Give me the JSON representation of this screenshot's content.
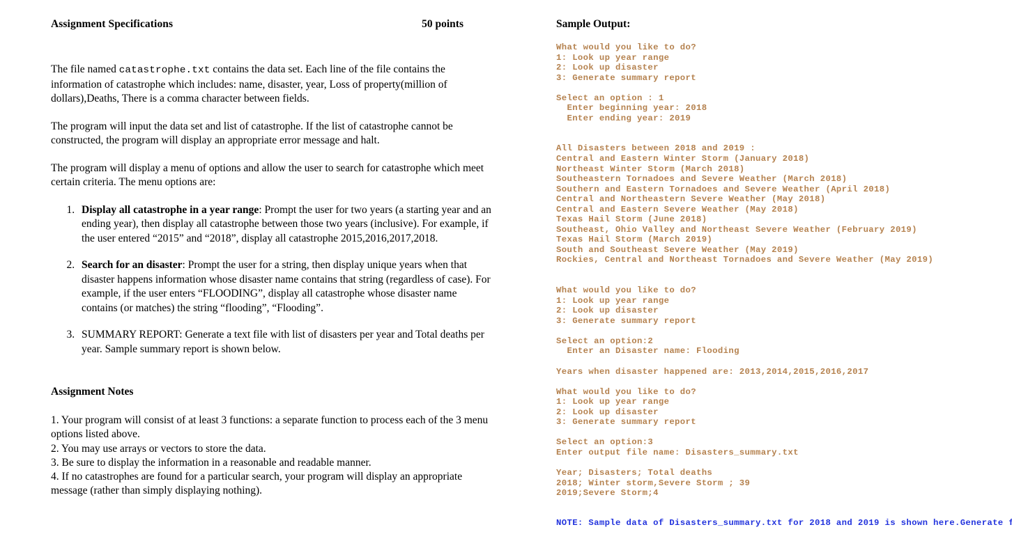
{
  "left": {
    "heading": "Assignment Specifications",
    "points": "50 points",
    "para1_a": "The file named ",
    "para1_file": "catastrophe.txt",
    "para1_b": " contains the data set.  Each line of the file contains the information of catastrophe which includes:  name, disaster, year, Loss of property(million of dollars),Deaths, There is a comma character between fields.",
    "para2": "The program will input the data set and list of catastrophe.  If the list of catastrophe cannot be constructed, the program will display an appropriate error message and halt.",
    "para3": "The program will display a menu of options and allow the user to search for catastrophe which meet certain criteria.  The menu options are:",
    "menu_items": [
      {
        "bold": "Display all catastrophe in a year range",
        "rest": ":  Prompt the user for two years (a starting year and an ending year), then display all catastrophe between those two years (inclusive).  For example, if the user entered “2015” and “2018”, display all catastrophe 2015,2016,2017,2018."
      },
      {
        "bold": "Search for an disaster",
        "rest": ":  Prompt the user for a string, then display unique years when that disaster happens information whose disaster name contains that string (regardless of case).  For example, if the user enters “FLOODING”, display all catastrophe whose disaster name contains (or matches) the string “flooding”, “Flooding”."
      },
      {
        "bold": "",
        "rest": "SUMMARY REPORT: Generate a text file with list of disasters per year and Total deaths per year. Sample summary report is shown below."
      }
    ],
    "notes_heading": "Assignment Notes",
    "notes": [
      "1.  Your program will consist of at least 3 functions:  a separate function to process each of the 3 menu options listed above.",
      "2.  You may use arrays or vectors to store the data.",
      "3.  Be sure to display the information in a reasonable and readable manner.",
      "4.  If no catastrophes are found for a particular search, your program will display an appropriate message (rather than simply displaying nothing)."
    ]
  },
  "right": {
    "heading": "Sample Output:",
    "console_color": "#b5824f",
    "note_color": "#2233dd",
    "console_lines": [
      "What would you like to do?",
      "1: Look up year range",
      "2: Look up disaster",
      "3: Generate summary report",
      "",
      "Select an option : 1",
      "  Enter beginning year: 2018",
      "  Enter ending year: 2019",
      "",
      "",
      "All Disasters between 2018 and 2019 :",
      "Central and Eastern Winter Storm (January 2018)",
      "Northeast Winter Storm (March 2018)",
      "Southeastern Tornadoes and Severe Weather (March 2018)",
      "Southern and Eastern Tornadoes and Severe Weather (April 2018)",
      "Central and Northeastern Severe Weather (May 2018)",
      "Central and Eastern Severe Weather (May 2018)",
      "Texas Hail Storm (June 2018)",
      "Southeast, Ohio Valley and Northeast Severe Weather (February 2019)",
      "Texas Hail Storm (March 2019)",
      "South and Southeast Severe Weather (May 2019)",
      "Rockies, Central and Northeast Tornadoes and Severe Weather (May 2019)",
      "",
      "",
      "What would you like to do?",
      "1: Look up year range",
      "2: Look up disaster",
      "3: Generate summary report",
      "",
      "Select an option:2",
      "  Enter an Disaster name: Flooding",
      "",
      "Years when disaster happened are: 2013,2014,2015,2016,2017",
      "",
      "What would you like to do?",
      "1: Look up year range",
      "2: Look up disaster",
      "3: Generate summary report",
      "",
      "Select an option:3",
      "Enter output file name: Disasters_summary.txt",
      "",
      "Year; Disasters; Total deaths",
      "2018; Winter storm,Severe Storm ; 39",
      "2019;Severe Storm;4"
    ],
    "note_lines": [
      "NOTE: Sample data of Disasters_summary.txt for 2018 and 2019 is shown here.",
      "Generate for all the years."
    ]
  }
}
